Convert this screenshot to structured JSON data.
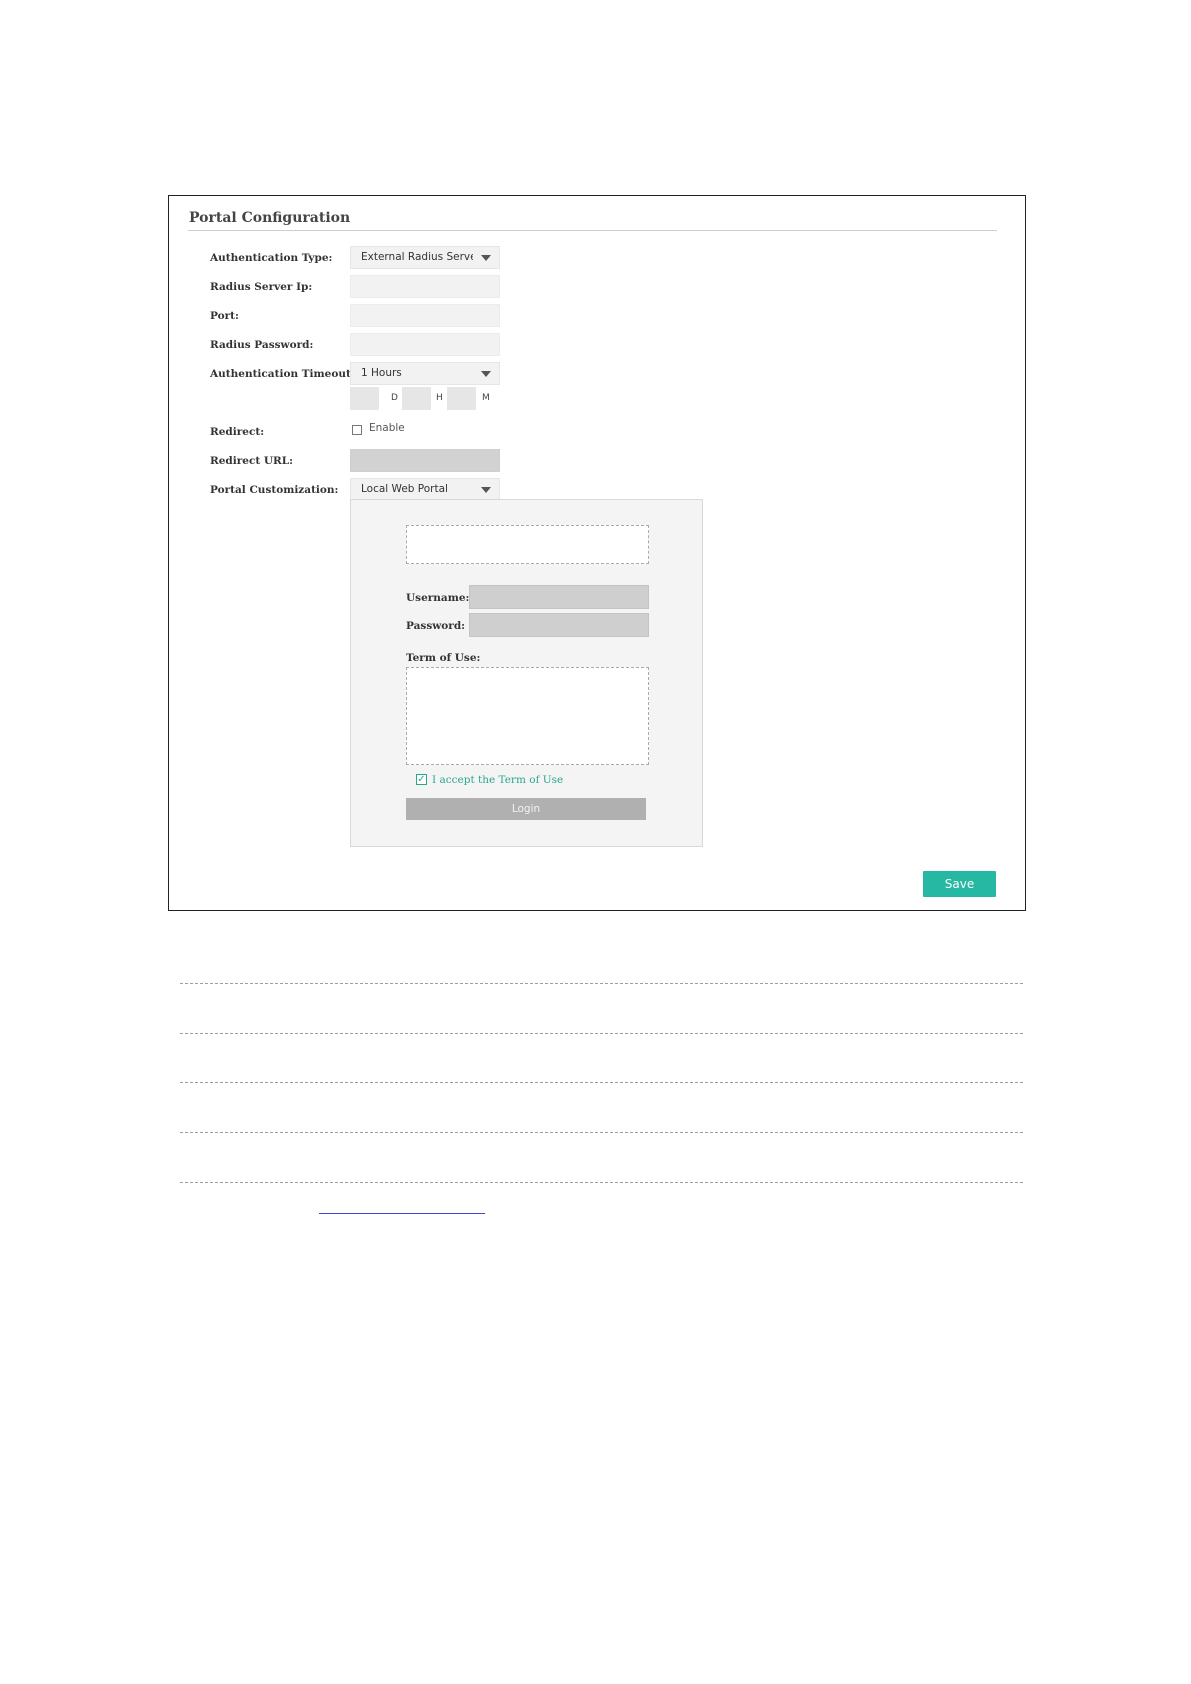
{
  "panel": {
    "title": "Portal Configuration",
    "labels": {
      "auth_type": "Authentication Type:",
      "radius_ip": "Radius Server Ip:",
      "port": "Port:",
      "radius_password": "Radius Password:",
      "auth_timeout": "Authentication Timeout:",
      "redirect": "Redirect:",
      "redirect_url": "Redirect URL:",
      "portal_custom": "Portal Customization:"
    },
    "auth_type_value": "External Radius Server",
    "radius_ip_value": "",
    "port_value": "",
    "radius_password_value": "",
    "auth_timeout_value": "1 Hours",
    "timeout_units": {
      "d": "D",
      "h": "H",
      "m": "M"
    },
    "redirect_enable_label": "Enable",
    "redirect_checked": false,
    "redirect_url_value": "",
    "portal_custom_value": "Local Web Portal",
    "save_label": "Save"
  },
  "preview": {
    "username_label": "Username:",
    "password_label": "Password:",
    "terms_label": "Term of Use:",
    "accept_label": "I accept the Term of Use",
    "accept_checked": true,
    "login_label": "Login"
  },
  "icons": {
    "dropdown": "caret-down-icon",
    "check": "checkmark-icon"
  },
  "colors": {
    "accent": "#26b8a2",
    "accept_text": "#2aa78f",
    "login_button": "#b0b0b0"
  }
}
